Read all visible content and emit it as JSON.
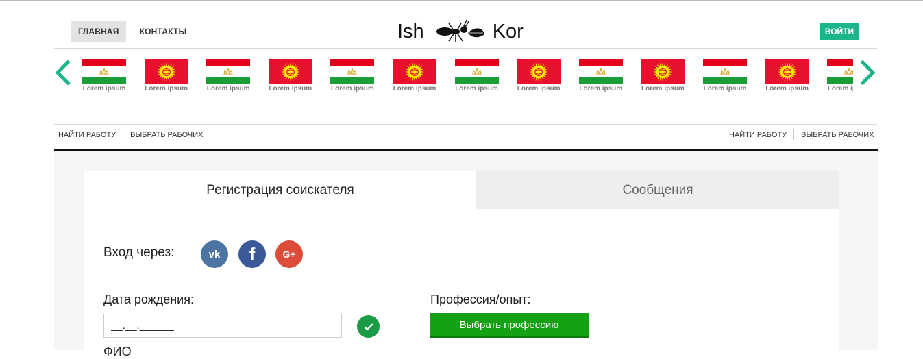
{
  "header": {
    "nav": [
      {
        "label": "ГЛАВНАЯ",
        "active": true
      },
      {
        "label": "КОНТАКТЫ",
        "active": false
      }
    ],
    "logo_left": "Ish",
    "logo_right": "Kor",
    "login_label": "ВОЙТИ"
  },
  "carousel": {
    "items": [
      {
        "flag": "tajikistan",
        "label": "Lorem ipsum"
      },
      {
        "flag": "kyrgyzstan",
        "label": "Lorem ipsum"
      },
      {
        "flag": "tajikistan",
        "label": "Lorem ipsum"
      },
      {
        "flag": "kyrgyzstan",
        "label": "Lorem ipsum"
      },
      {
        "flag": "tajikistan",
        "label": "Lorem ipsum"
      },
      {
        "flag": "kyrgyzstan",
        "label": "Lorem ipsum"
      },
      {
        "flag": "tajikistan",
        "label": "Lorem ipsum"
      },
      {
        "flag": "kyrgyzstan",
        "label": "Lorem ipsum"
      },
      {
        "flag": "tajikistan",
        "label": "Lorem ipsum"
      },
      {
        "flag": "kyrgyzstan",
        "label": "Lorem ipsum"
      },
      {
        "flag": "tajikistan",
        "label": "Lorem ipsum"
      },
      {
        "flag": "kyrgyzstan",
        "label": "Lorem ipsum"
      },
      {
        "flag": "tajikistan",
        "label": "Lorem ipsum"
      }
    ],
    "prev_icon": "chevron-left-icon",
    "next_icon": "chevron-right-icon"
  },
  "subnav_left": [
    "НАЙТИ РАБОТУ",
    "ВЫБРАТЬ РАБОЧИХ"
  ],
  "subnav_right": [
    "НАЙТИ РАБОТУ",
    "ВЫБРАТЬ РАБОЧИХ"
  ],
  "tabs": {
    "active": "Регистрация соискателя",
    "inactive": "Сообщения"
  },
  "form": {
    "social_label": "Вход через:",
    "social": {
      "vk": "vk",
      "fb": "f",
      "gp": "G+"
    },
    "dob_label": "Дата рождения:",
    "dob_value": "__.__.______",
    "profession_label": "Профессия/опыт:",
    "profession_button": "Выбрать профессию",
    "fio_label": "ФИО"
  },
  "colors": {
    "accent": "#1bb58b",
    "button_green": "#14a114",
    "vk": "#4c75a3",
    "facebook": "#3b5998",
    "google": "#dd4b39"
  }
}
